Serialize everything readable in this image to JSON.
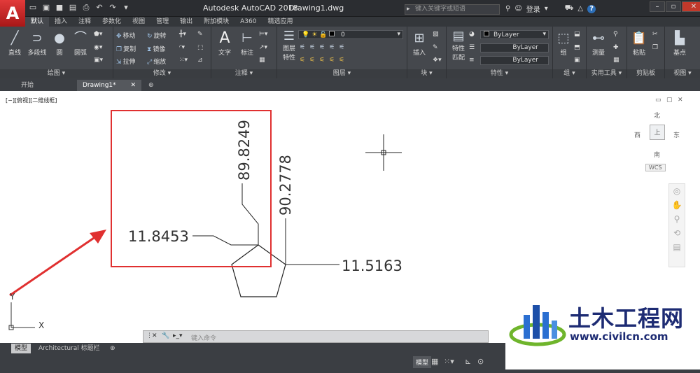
{
  "titlebar": {
    "app_title": "Autodesk AutoCAD 2018",
    "doc_title": "Drawing1.dwg",
    "search_placeholder": "键入关键字或短语",
    "login_label": "登录",
    "help_label": "?"
  },
  "tabs": [
    "默认",
    "插入",
    "注释",
    "参数化",
    "视图",
    "管理",
    "输出",
    "附加模块",
    "A360",
    "精选应用"
  ],
  "ribbon": {
    "draw": {
      "title": "绘图 ▾",
      "line": "直线",
      "polyline": "多段线",
      "circle": "圆",
      "arc": "圆弧"
    },
    "modify": {
      "title": "修改 ▾",
      "move": "移动",
      "rotate": "旋转",
      "copy": "复制",
      "mirror": "镜像",
      "stretch": "拉伸",
      "scale": "缩放"
    },
    "annotation": {
      "title": "注释 ▾",
      "text": "文字",
      "dim": "标注"
    },
    "layers": {
      "title": "图层 ▾",
      "layer_props": "图层",
      "layer_props2": "特性",
      "current_layer": "0"
    },
    "block": {
      "title": "块 ▾",
      "insert": "插入"
    },
    "properties": {
      "title": "特性 ▾",
      "match1": "特性",
      "match2": "匹配",
      "color": "ByLayer",
      "linetype": "ByLayer",
      "lineweight": "ByLayer"
    },
    "groups": {
      "title": "组 ▾",
      "group": "组"
    },
    "utilities": {
      "title": "实用工具 ▾",
      "measure": "测量"
    },
    "clipboard": {
      "title": "剪贴板",
      "paste": "粘贴"
    },
    "view": {
      "title": "视图 ▾",
      "base": "基点"
    }
  },
  "doctabs": {
    "start": "开始",
    "drawing": "Drawing1*"
  },
  "viewport_label": "[−][俯视][二维线框]",
  "navcube": {
    "north": "北",
    "south": "南",
    "east": "东",
    "west": "西",
    "top": "上",
    "wcs": "WCS"
  },
  "drawing": {
    "dims": [
      "89.8249",
      "90.2778",
      "11.8453",
      "11.5163"
    ],
    "ucs_x": "X",
    "ucs_y": "Y",
    "highlight_color": "#e03030"
  },
  "cmdline_placeholder": "键入命令",
  "layout_tabs": {
    "model": "模型",
    "layout": "Architectural 标题栏"
  },
  "status": {
    "model": "模型"
  },
  "watermark": {
    "name": "土木工程网",
    "url": "www.civilcn.com"
  }
}
